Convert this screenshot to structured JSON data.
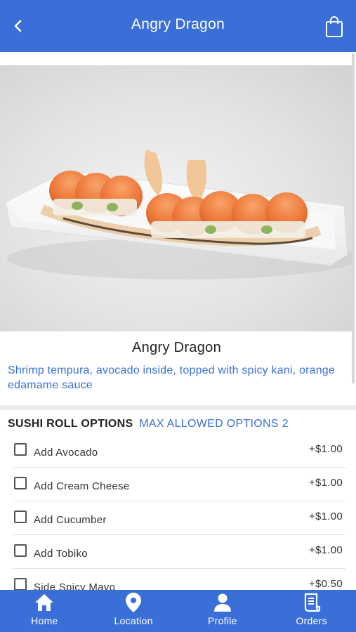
{
  "header": {
    "title": "Angry Dragon",
    "back_icon": "chevron-left-icon",
    "cart_icon": "shopping-bag-icon"
  },
  "item": {
    "name": "Angry Dragon",
    "description": "Shrimp tempura, avocado inside, topped with spicy kani, orange edamame sauce",
    "image": "sushi-roll-photo"
  },
  "options": {
    "title": "SUSHI ROLL OPTIONS",
    "max_label": "MAX ALLOWED OPTIONS 2",
    "items": [
      {
        "label": "Add Avocado",
        "price": "+$1.00",
        "checked": false
      },
      {
        "label": "Add Cream Cheese",
        "price": "+$1.00",
        "checked": false
      },
      {
        "label": "Add Cucumber",
        "price": "+$1.00",
        "checked": false
      },
      {
        "label": "Add Tobiko",
        "price": "+$1.00",
        "checked": false
      },
      {
        "label": "Side Spicy Mayo",
        "price": "+$0.50",
        "checked": false
      }
    ]
  },
  "nav": {
    "items": [
      {
        "label": "Home",
        "icon": "home-icon"
      },
      {
        "label": "Location",
        "icon": "location-pin-icon"
      },
      {
        "label": "Profile",
        "icon": "person-icon"
      },
      {
        "label": "Orders",
        "icon": "receipt-icon"
      }
    ]
  },
  "colors": {
    "primary": "#3a6fd8",
    "background": "#ffffff",
    "text": "#222222"
  }
}
